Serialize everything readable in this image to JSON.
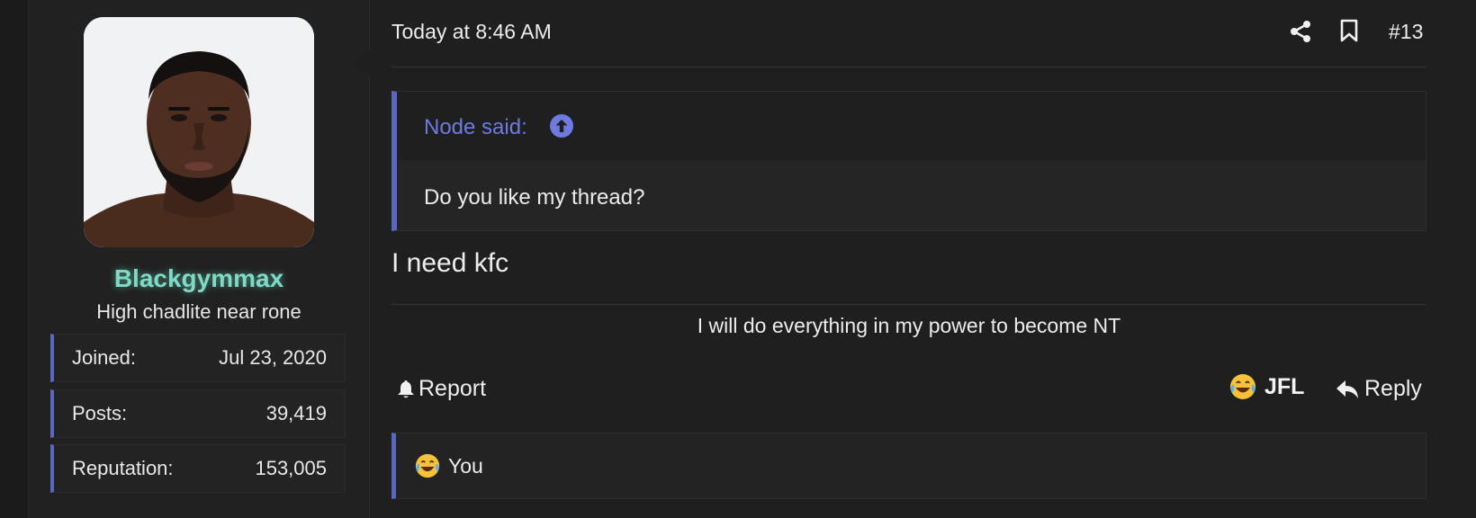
{
  "user": {
    "username": "Blackgymmax",
    "title": "High chadlite near rone",
    "stats": [
      {
        "label": "Joined:",
        "value": "Jul 23, 2020"
      },
      {
        "label": "Posts:",
        "value": "39,419"
      },
      {
        "label": "Reputation:",
        "value": "153,005"
      }
    ]
  },
  "post": {
    "date": "Today at 8:46 AM",
    "number": "#13",
    "quote": {
      "author": "Node said:",
      "text": "Do you like my thread?"
    },
    "message": "I need kfc",
    "signature": "I will do everything in my power to become NT"
  },
  "actions": {
    "report_label": "Report",
    "react_label": "JFL",
    "reply_label": "Reply"
  },
  "reactions": {
    "summary": "You"
  },
  "icons": [
    "share-icon",
    "bookmark-icon",
    "arrow-up-circle-icon",
    "bell-icon",
    "reply-icon",
    "crying-laughing-emoji"
  ],
  "colors": {
    "accent": "#5b66c2",
    "quote_author": "#6f7ae0",
    "username": "#7fd9c5",
    "background": "#1f1f1f"
  }
}
